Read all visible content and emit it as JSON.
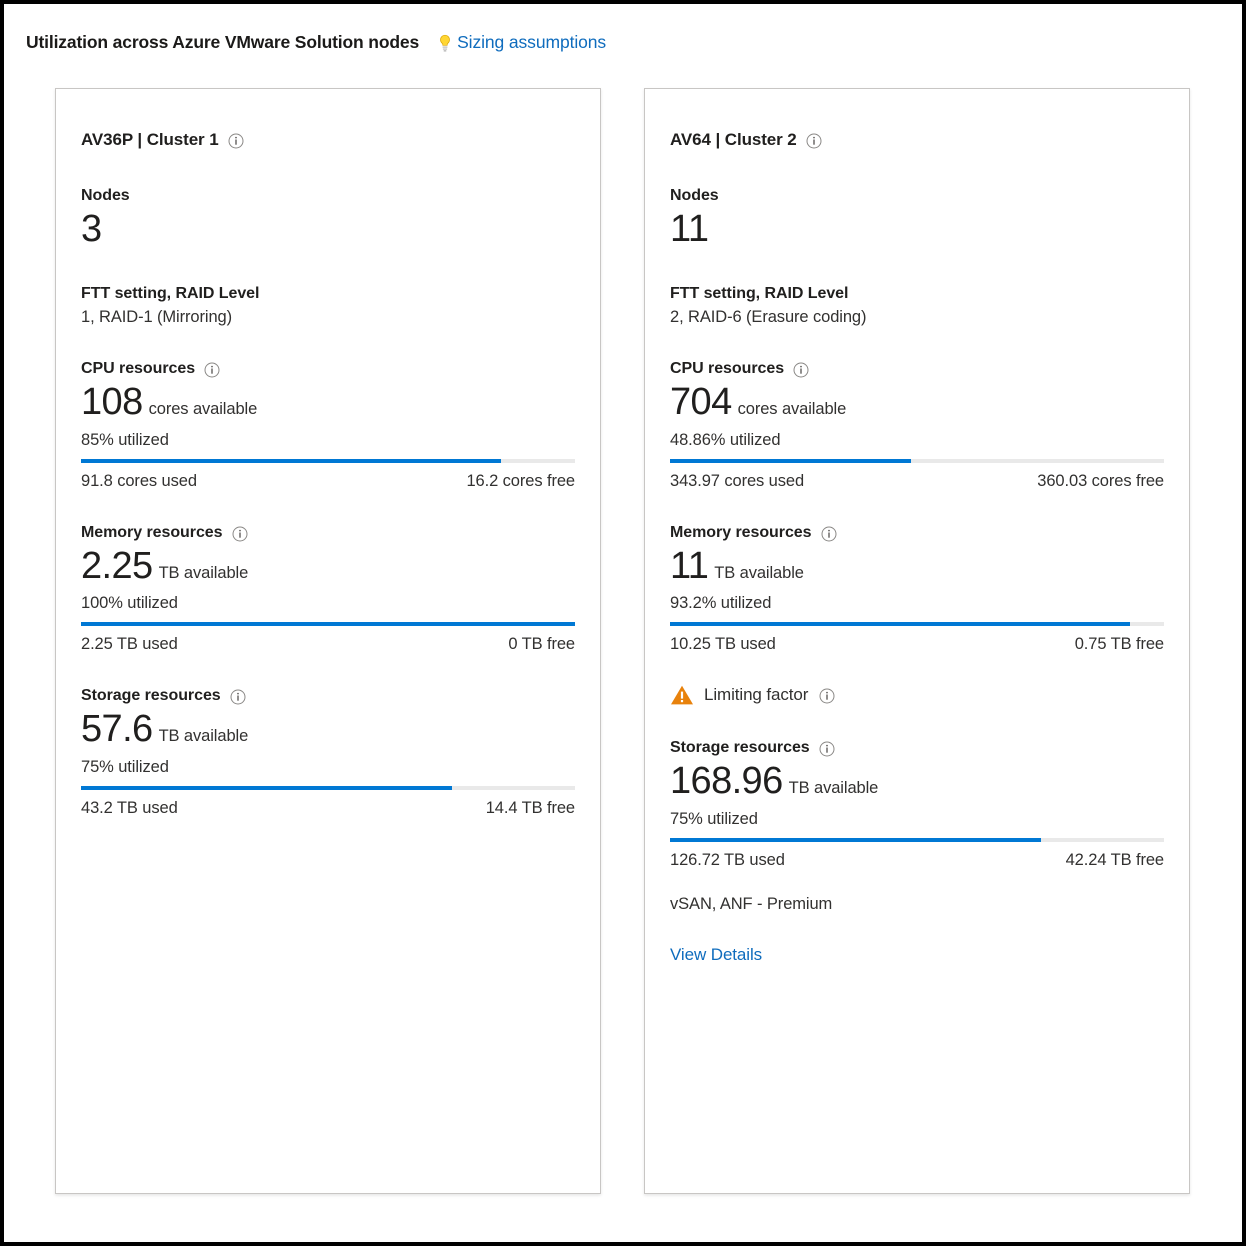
{
  "header": {
    "title": "Utilization across Azure VMware Solution nodes",
    "sizing_link": "Sizing assumptions",
    "bulb_icon": "lightbulb-icon"
  },
  "colors": {
    "accent_blue": "#0078d4",
    "link_blue": "#0f6cbd",
    "track_gray": "#e9e9e9",
    "warning_orange": "#e8820c",
    "bulb_yellow": "#ffd633",
    "card_border": "#c8c6c4",
    "text": "#201f1e"
  },
  "cards": [
    {
      "title": "AV36P | Cluster 1",
      "title_info_icon": "info-icon",
      "nodes_label": "Nodes",
      "nodes_value": "3",
      "ftt_label": "FTT setting, RAID Level",
      "ftt_value": "1, RAID-1 (Mirroring)",
      "cpu": {
        "heading": "CPU resources",
        "value": "108",
        "unit": "cores available",
        "utilized": "85% utilized",
        "percent": 85,
        "used": "91.8 cores used",
        "free": "16.2 cores free"
      },
      "memory": {
        "heading": "Memory resources",
        "value": "2.25",
        "unit": "TB available",
        "utilized": "100% utilized",
        "percent": 100,
        "used": "2.25 TB used",
        "free": "0 TB free"
      },
      "limiting": null,
      "storage": {
        "heading": "Storage resources",
        "value": "57.6",
        "unit": "TB available",
        "utilized": "75% utilized",
        "percent": 75,
        "used": "43.2 TB used",
        "free": "14.4 TB free",
        "note": null
      },
      "view_details": null
    },
    {
      "title": "AV64 | Cluster 2",
      "title_info_icon": "info-icon",
      "nodes_label": "Nodes",
      "nodes_value": "11",
      "ftt_label": "FTT setting, RAID Level",
      "ftt_value": "2, RAID-6 (Erasure coding)",
      "cpu": {
        "heading": "CPU resources",
        "value": "704",
        "unit": "cores available",
        "utilized": "48.86% utilized",
        "percent": 48.86,
        "used": "343.97 cores used",
        "free": "360.03 cores free"
      },
      "memory": {
        "heading": "Memory resources",
        "value": "11",
        "unit": "TB available",
        "utilized": "93.2% utilized",
        "percent": 93.2,
        "used": "10.25 TB used",
        "free": "0.75 TB free"
      },
      "limiting": "Limiting factor",
      "storage": {
        "heading": "Storage resources",
        "value": "168.96",
        "unit": "TB available",
        "utilized": "75% utilized",
        "percent": 75,
        "used": "126.72 TB used",
        "free": "42.24 TB free",
        "note": "vSAN, ANF - Premium"
      },
      "view_details": "View Details"
    }
  ]
}
